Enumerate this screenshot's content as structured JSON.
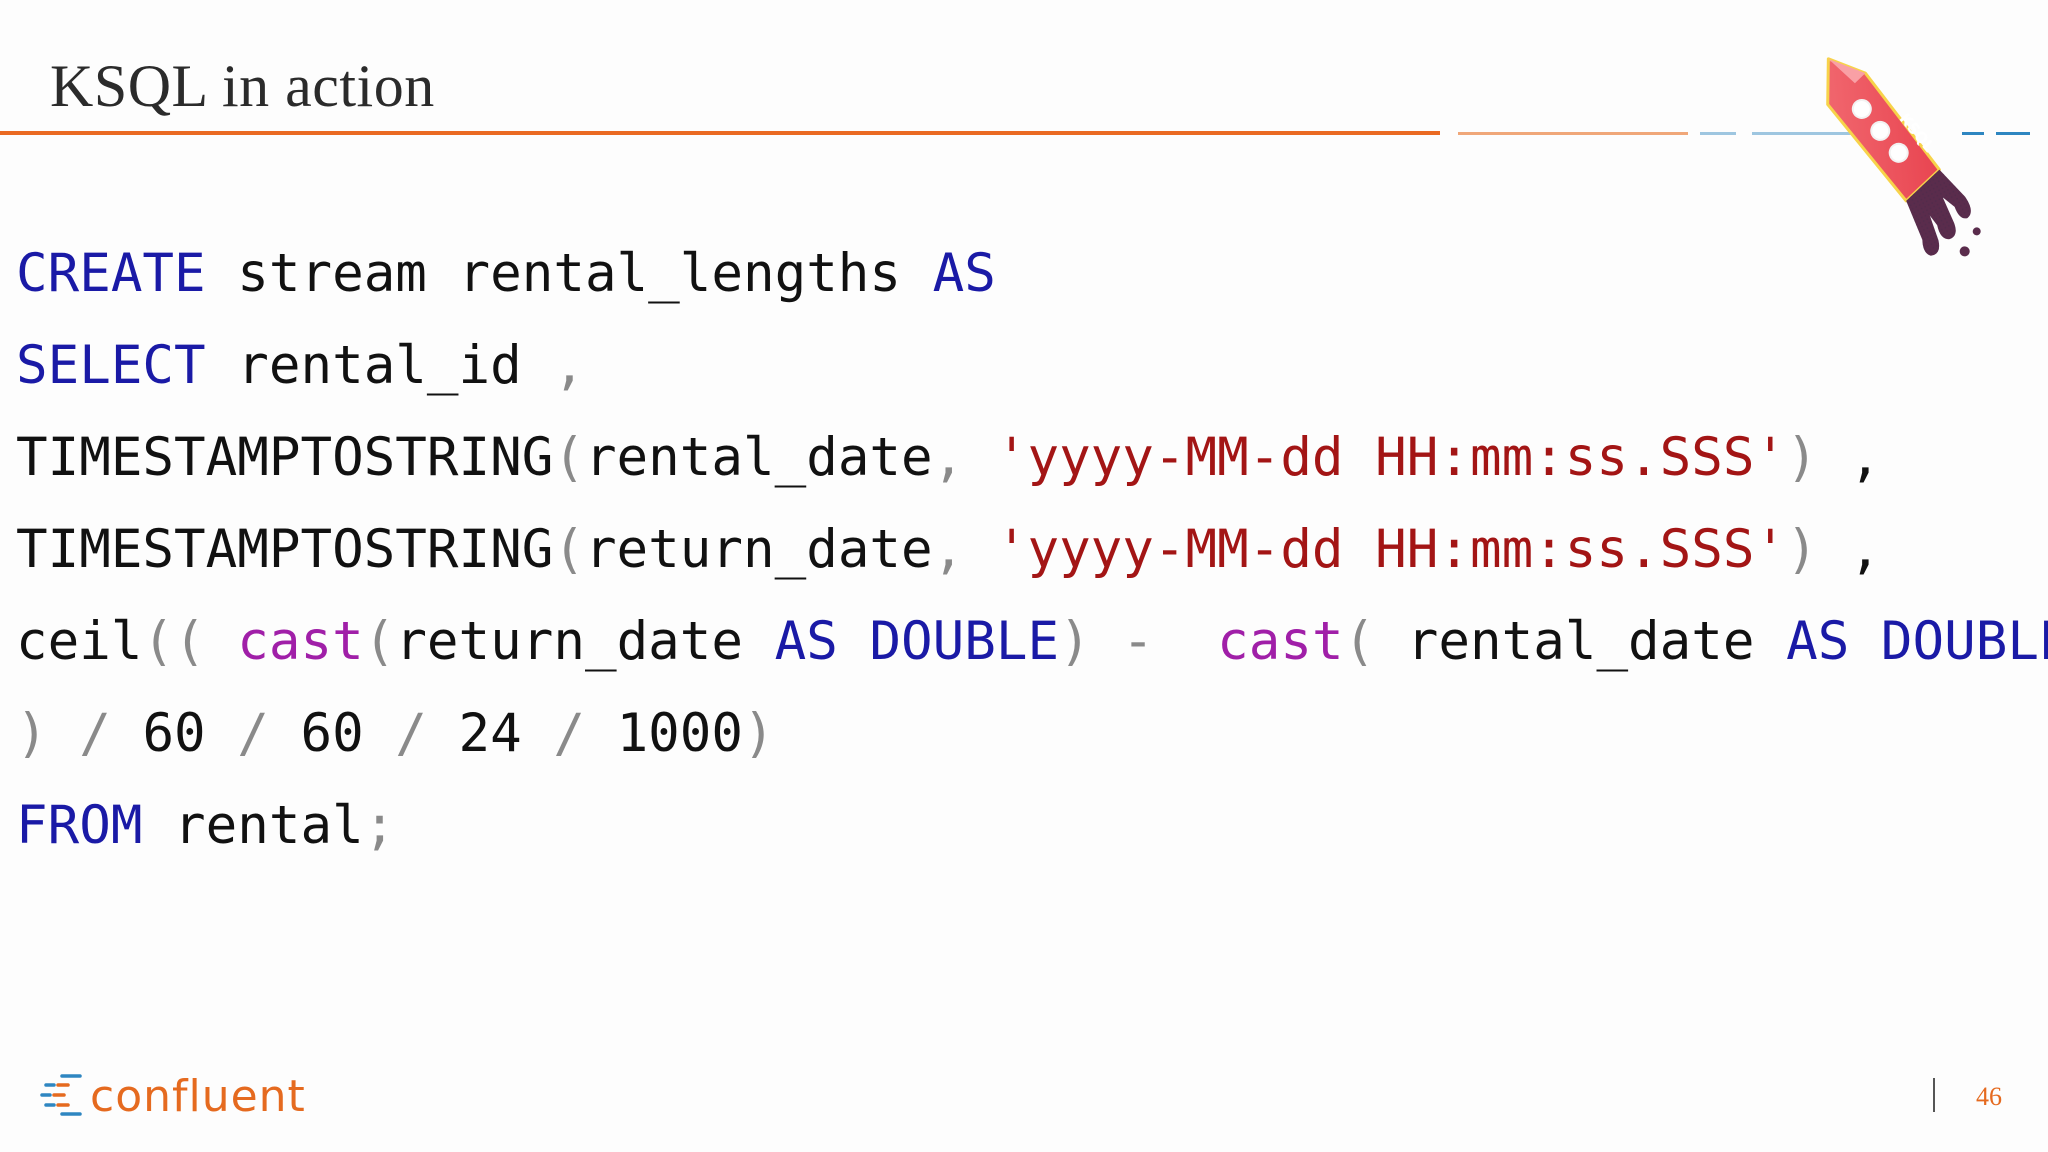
{
  "slide": {
    "title": "KSQL in action",
    "page_number": "46",
    "logo_text": "confluent",
    "rocket_label": "KSQL"
  },
  "colors": {
    "accent_orange": "#ea6a22",
    "accent_blue": "#2e86c1",
    "keyword": "#1a1aa6",
    "function_cast": "#a01fa8",
    "string": "#a31515",
    "text": "#111111",
    "punctuation": "#8a8a8a"
  },
  "icons": [
    "ksql-rocket-icon",
    "confluent-logo-icon"
  ],
  "code": {
    "language": "KSQL",
    "lines": [
      [
        {
          "t": "CREATE",
          "k": "kw"
        },
        {
          "t": " stream rental_lengths ",
          "k": "id"
        },
        {
          "t": "AS",
          "k": "kw"
        }
      ],
      [
        {
          "t": "SELECT",
          "k": "kw"
        },
        {
          "t": " rental_id ",
          "k": "id"
        },
        {
          "t": ",",
          "k": "punc"
        }
      ],
      [
        {
          "t": "TIMESTAMPTOSTRING",
          "k": "fn"
        },
        {
          "t": "(",
          "k": "punc"
        },
        {
          "t": "rental_date",
          "k": "id"
        },
        {
          "t": ", ",
          "k": "punc"
        },
        {
          "t": "'yyyy-MM-dd HH:mm:ss.SSS'",
          "k": "str"
        },
        {
          "t": ")",
          "k": "punc"
        },
        {
          "t": " ,",
          "k": "id"
        }
      ],
      [
        {
          "t": "TIMESTAMPTOSTRING",
          "k": "fn"
        },
        {
          "t": "(",
          "k": "punc"
        },
        {
          "t": "return_date",
          "k": "id"
        },
        {
          "t": ", ",
          "k": "punc"
        },
        {
          "t": "'yyyy-MM-dd HH:mm:ss.SSS'",
          "k": "str"
        },
        {
          "t": ")",
          "k": "punc"
        },
        {
          "t": " ,",
          "k": "id"
        }
      ],
      [
        {
          "t": "ceil",
          "k": "id"
        },
        {
          "t": "((",
          "k": "punc"
        },
        {
          "t": " ",
          "k": "id"
        },
        {
          "t": "cast",
          "k": "cast"
        },
        {
          "t": "(",
          "k": "punc"
        },
        {
          "t": "return_date ",
          "k": "id"
        },
        {
          "t": "AS",
          "k": "kw"
        },
        {
          "t": " ",
          "k": "id"
        },
        {
          "t": "DOUBLE",
          "k": "kw"
        },
        {
          "t": ")",
          "k": "punc"
        },
        {
          "t": " - ",
          "k": "op"
        },
        {
          "t": " ",
          "k": "id"
        },
        {
          "t": "cast",
          "k": "cast"
        },
        {
          "t": "(",
          "k": "punc"
        },
        {
          "t": " rental_date ",
          "k": "id"
        },
        {
          "t": "AS",
          "k": "kw"
        },
        {
          "t": " ",
          "k": "id"
        },
        {
          "t": "DOUBLE",
          "k": "kw"
        },
        {
          "t": ")",
          "k": "punc"
        }
      ],
      [
        {
          "t": ")",
          "k": "punc"
        },
        {
          "t": " / ",
          "k": "op"
        },
        {
          "t": "60",
          "k": "num"
        },
        {
          "t": " / ",
          "k": "op"
        },
        {
          "t": "60",
          "k": "num"
        },
        {
          "t": " / ",
          "k": "op"
        },
        {
          "t": "24",
          "k": "num"
        },
        {
          "t": " / ",
          "k": "op"
        },
        {
          "t": "1000",
          "k": "num"
        },
        {
          "t": ")",
          "k": "punc"
        }
      ],
      [
        {
          "t": "FROM",
          "k": "kw"
        },
        {
          "t": " rental",
          "k": "id"
        },
        {
          "t": ";",
          "k": "punc"
        }
      ]
    ]
  }
}
